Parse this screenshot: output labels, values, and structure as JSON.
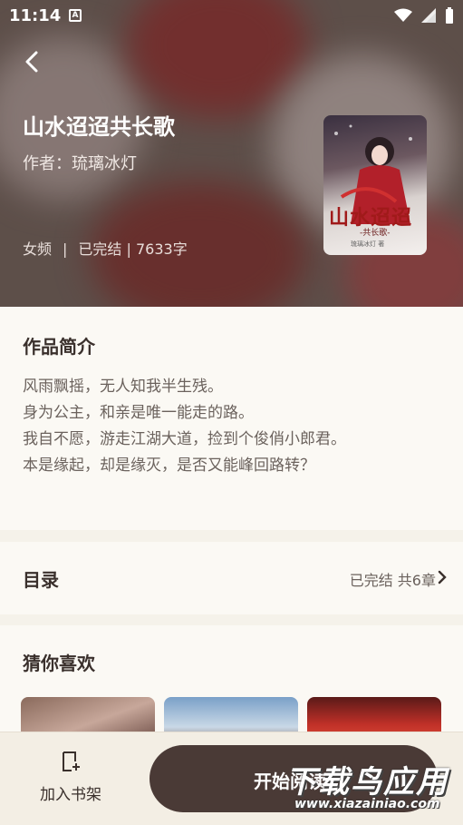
{
  "status_bar": {
    "time": "11:14",
    "app_icon_letter": "A"
  },
  "book": {
    "title": "山水迢迢共长歌",
    "author": "作者：琉璃冰灯",
    "category": "女频",
    "state_words": "已完结 | 7633字",
    "cover_title": "山水迢迢",
    "cover_subtitle": "-共长歌-",
    "cover_author": "琉璃冰灯 著"
  },
  "intro": {
    "heading": "作品简介",
    "lines": [
      "风雨飘摇，无人知我半生残。",
      "身为公主，和亲是唯一能走的路。",
      "我自不愿，游走江湖大道，捡到个俊俏小郎君。",
      "本是缘起，却是缘灭，是否又能峰回路转？"
    ]
  },
  "toc": {
    "heading": "目录",
    "status": "已完结 共6章"
  },
  "recommend": {
    "heading": "猜你喜欢"
  },
  "bottom": {
    "shelf_label": "加入书架",
    "start_label": "开始阅读"
  },
  "watermark": {
    "big": "下载鸟应用",
    "small": "www.xiazainiao.com"
  },
  "colors": {
    "accent": "#4a3a36",
    "background": "#fbf9f4"
  }
}
